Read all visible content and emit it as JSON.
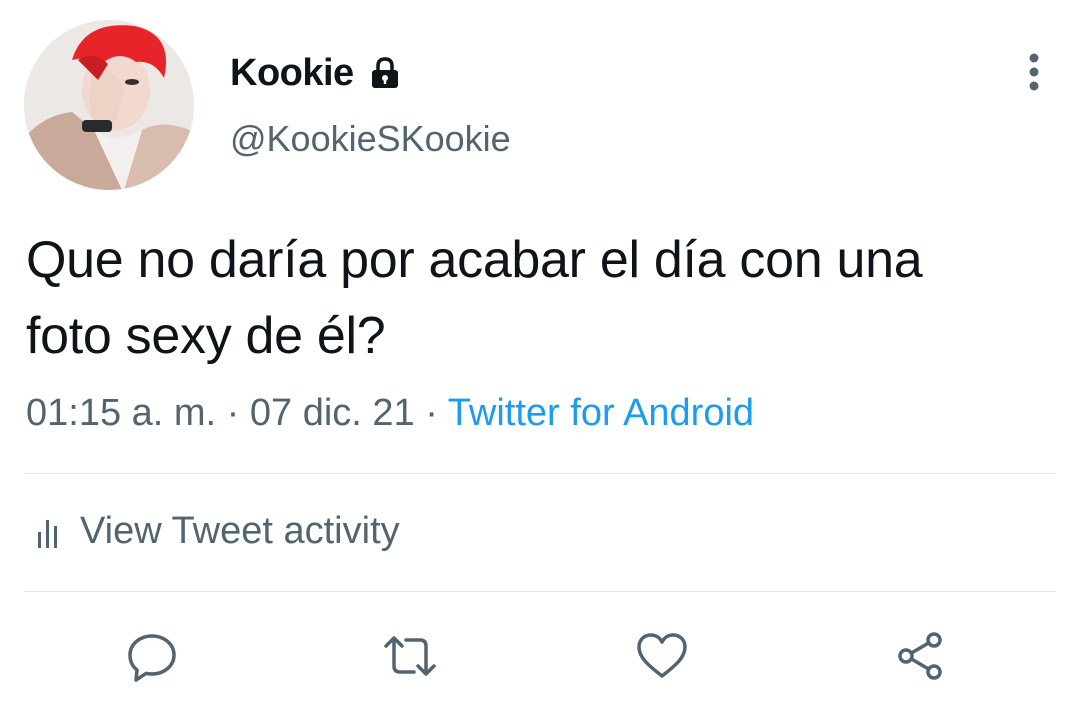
{
  "header": {
    "display_name": "Kookie",
    "handle": "@KookieSKookie",
    "protected_icon": "lock-icon",
    "menu_icon": "more-vertical-icon"
  },
  "tweet": {
    "text_line1": "Que no daría por acabar el día con una",
    "text_line2": "foto sexy de él?",
    "time": "01:15 a. m.",
    "separator": " · ",
    "date": "07 dic. 21",
    "source": "Twitter for Android"
  },
  "activity": {
    "label": "View Tweet activity",
    "icon": "analytics-icon"
  },
  "actions": [
    {
      "name": "reply",
      "icon": "reply-icon"
    },
    {
      "name": "retweet",
      "icon": "retweet-icon"
    },
    {
      "name": "like",
      "icon": "heart-icon"
    },
    {
      "name": "share",
      "icon": "share-icon"
    }
  ],
  "colors": {
    "text": "#0f1419",
    "secondary": "#536471",
    "link": "#1d9bf0",
    "divider": "#e3e6e8",
    "icon": "#536471",
    "avatar_hair": "#e8242b"
  }
}
